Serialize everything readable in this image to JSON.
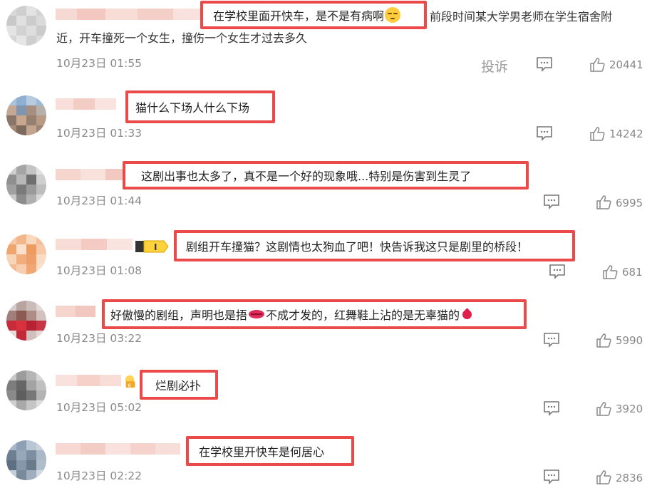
{
  "ui": {
    "report_label": "投诉"
  },
  "comments": [
    {
      "text_hl": "在学校里面开快车，是不是有病啊",
      "text_rest_line1": "前段时间某大学男老师在学生宿舍附",
      "text_line2": "近，开车撞死一个女生，撞伤一个女生才过去多久",
      "emoji_after_hl": "smirk-face",
      "time": "10月23日 01:55",
      "likes": "20441"
    },
    {
      "text_hl": "猫什么下场人什么下场",
      "time": "10月23日 01:33",
      "likes": "14242"
    },
    {
      "text_hl": "这剧出事也太多了，真不是一个好的现象哦...特别是伤害到生灵了",
      "time": "10月23日 01:44",
      "likes": "6995"
    },
    {
      "text_hl": "剧组开车撞猫？这剧情也太狗血了吧！快告诉我这只是剧里的桥段！",
      "time": "10月23日 01:08",
      "likes": "681",
      "badge_icon": "level-badge-icon"
    },
    {
      "text_a": "好傲慢的剧组，声明也是捂",
      "text_b": "不成才发的，红舞鞋上沾的是无辜猫的",
      "emoji_mid": "lips-emoji",
      "emoji_end": "blood-drop-emoji",
      "time": "10月23日 03:22",
      "likes": "5990"
    },
    {
      "text_hl": "烂剧必扑",
      "time": "10月23日 05:02",
      "likes": "3920",
      "badge_icon": "member-badge-icon"
    },
    {
      "text_hl": "在学校里开快车是何居心",
      "time": "10月23日 02:22",
      "likes": "2836"
    }
  ]
}
